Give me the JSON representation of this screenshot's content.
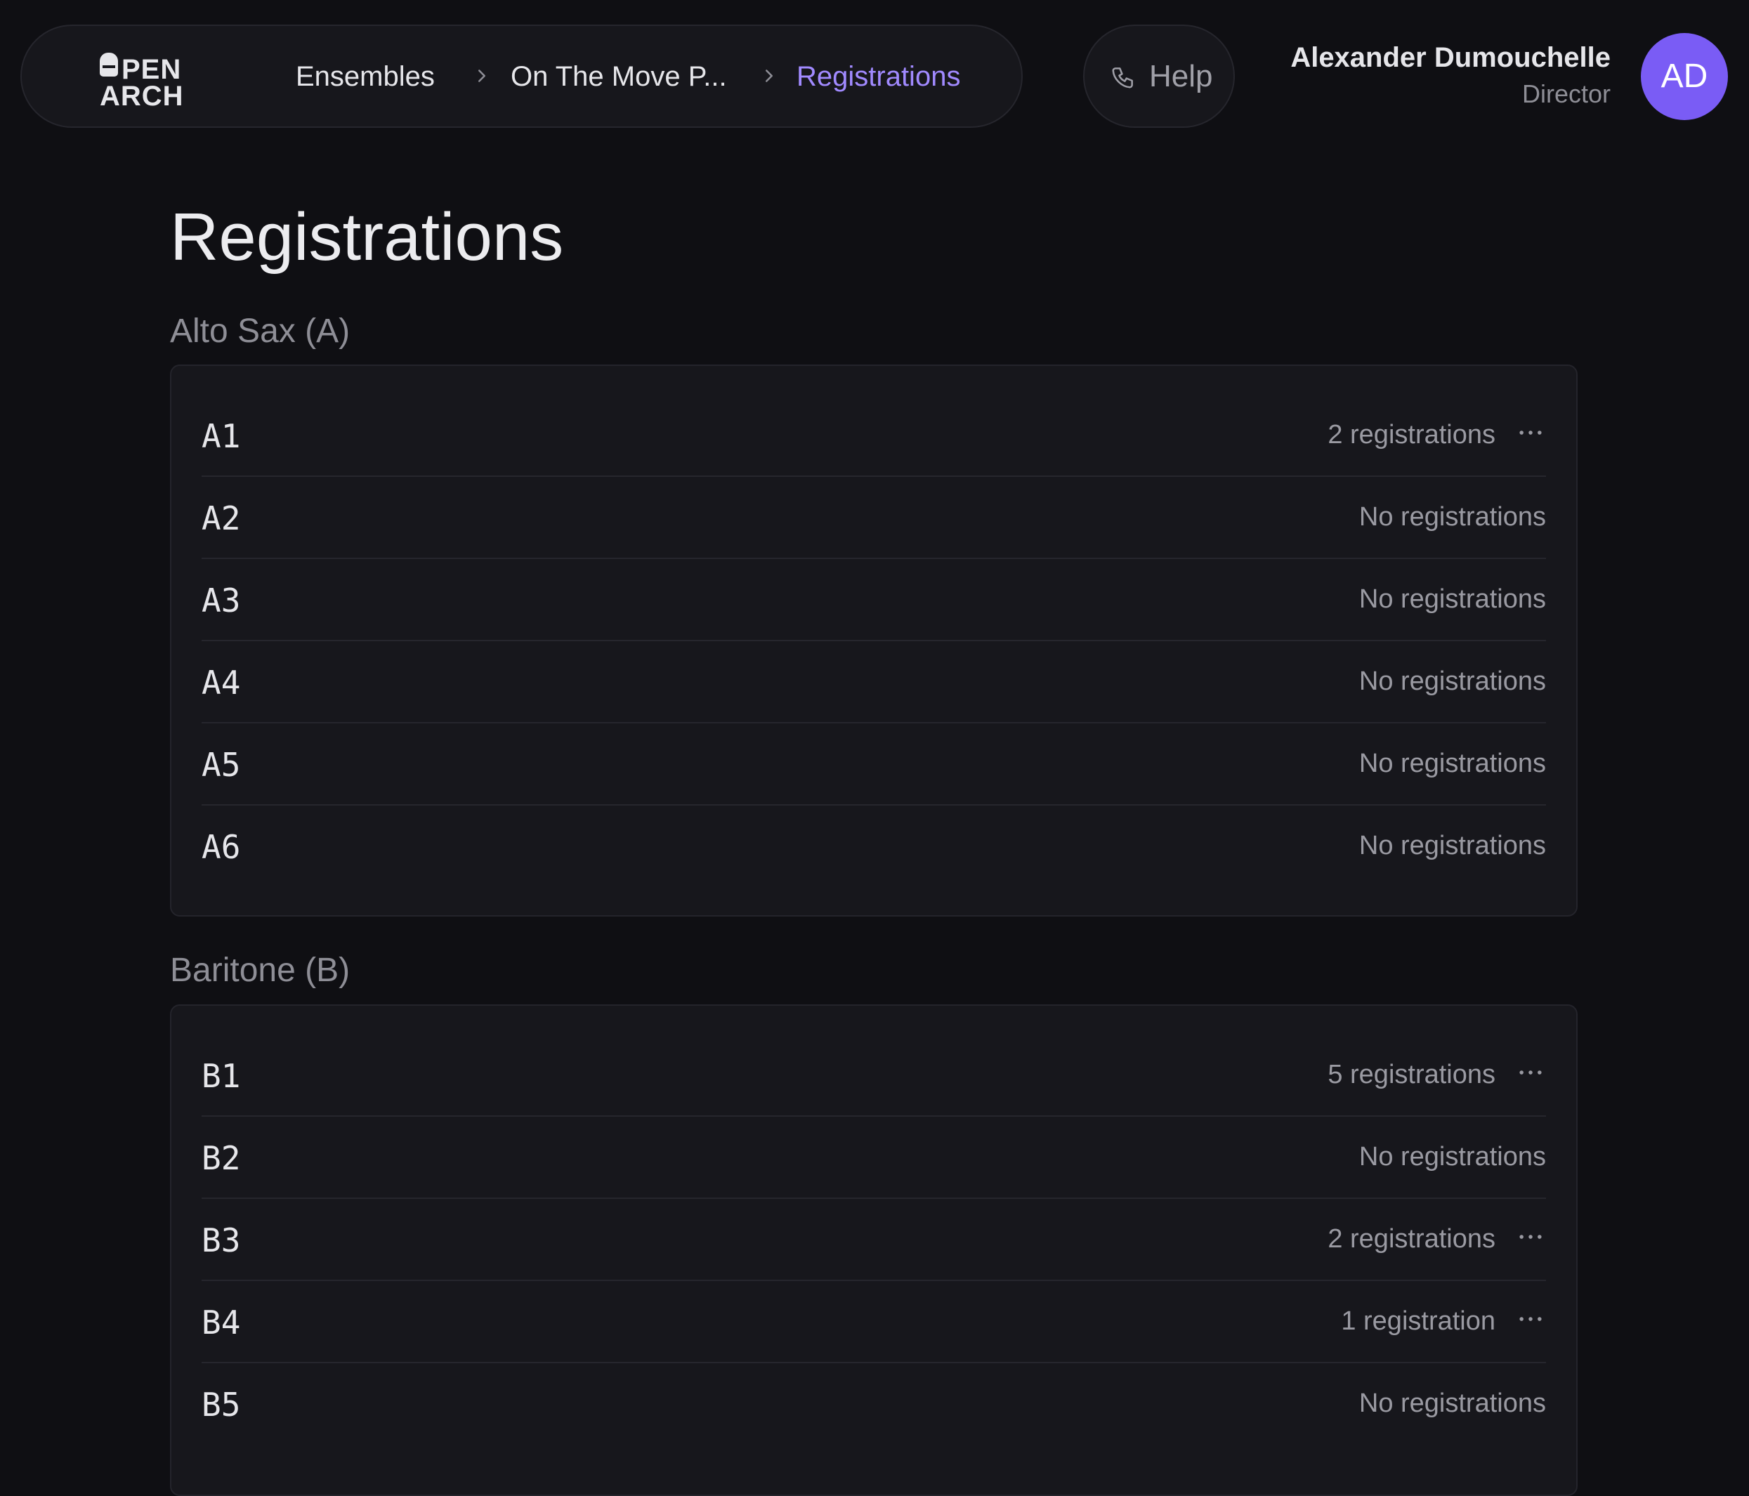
{
  "header": {
    "logo": {
      "line1": "PEN",
      "line2": "ARCH"
    },
    "breadcrumbs": [
      {
        "label": "Ensembles"
      },
      {
        "label": "On The Move P..."
      },
      {
        "label": "Registrations"
      }
    ],
    "help_label": "Help",
    "user": {
      "name": "Alexander Dumouchelle",
      "role": "Director",
      "initials": "AD"
    }
  },
  "main": {
    "title": "Registrations",
    "sections": [
      {
        "heading": "Alto Sax (A)",
        "rows": [
          {
            "label": "A1",
            "status": "2 registrations",
            "has_menu": true
          },
          {
            "label": "A2",
            "status": "No registrations",
            "has_menu": false
          },
          {
            "label": "A3",
            "status": "No registrations",
            "has_menu": false
          },
          {
            "label": "A4",
            "status": "No registrations",
            "has_menu": false
          },
          {
            "label": "A5",
            "status": "No registrations",
            "has_menu": false
          },
          {
            "label": "A6",
            "status": "No registrations",
            "has_menu": false
          }
        ]
      },
      {
        "heading": "Baritone (B)",
        "rows": [
          {
            "label": "B1",
            "status": "5 registrations",
            "has_menu": true
          },
          {
            "label": "B2",
            "status": "No registrations",
            "has_menu": false
          },
          {
            "label": "B3",
            "status": "2 registrations",
            "has_menu": true
          },
          {
            "label": "B4",
            "status": "1 registration",
            "has_menu": true
          },
          {
            "label": "B5",
            "status": "No registrations",
            "has_menu": false
          }
        ]
      }
    ]
  },
  "colors": {
    "background": "#0f0f13",
    "surface": "#17171c",
    "accent": "#a18aff",
    "avatar": "#7a5cf5"
  },
  "icons": {
    "help": "phone-icon",
    "breadcrumb_separator": "chevron-right-icon",
    "row_menu": "more-horizontal-icon"
  }
}
